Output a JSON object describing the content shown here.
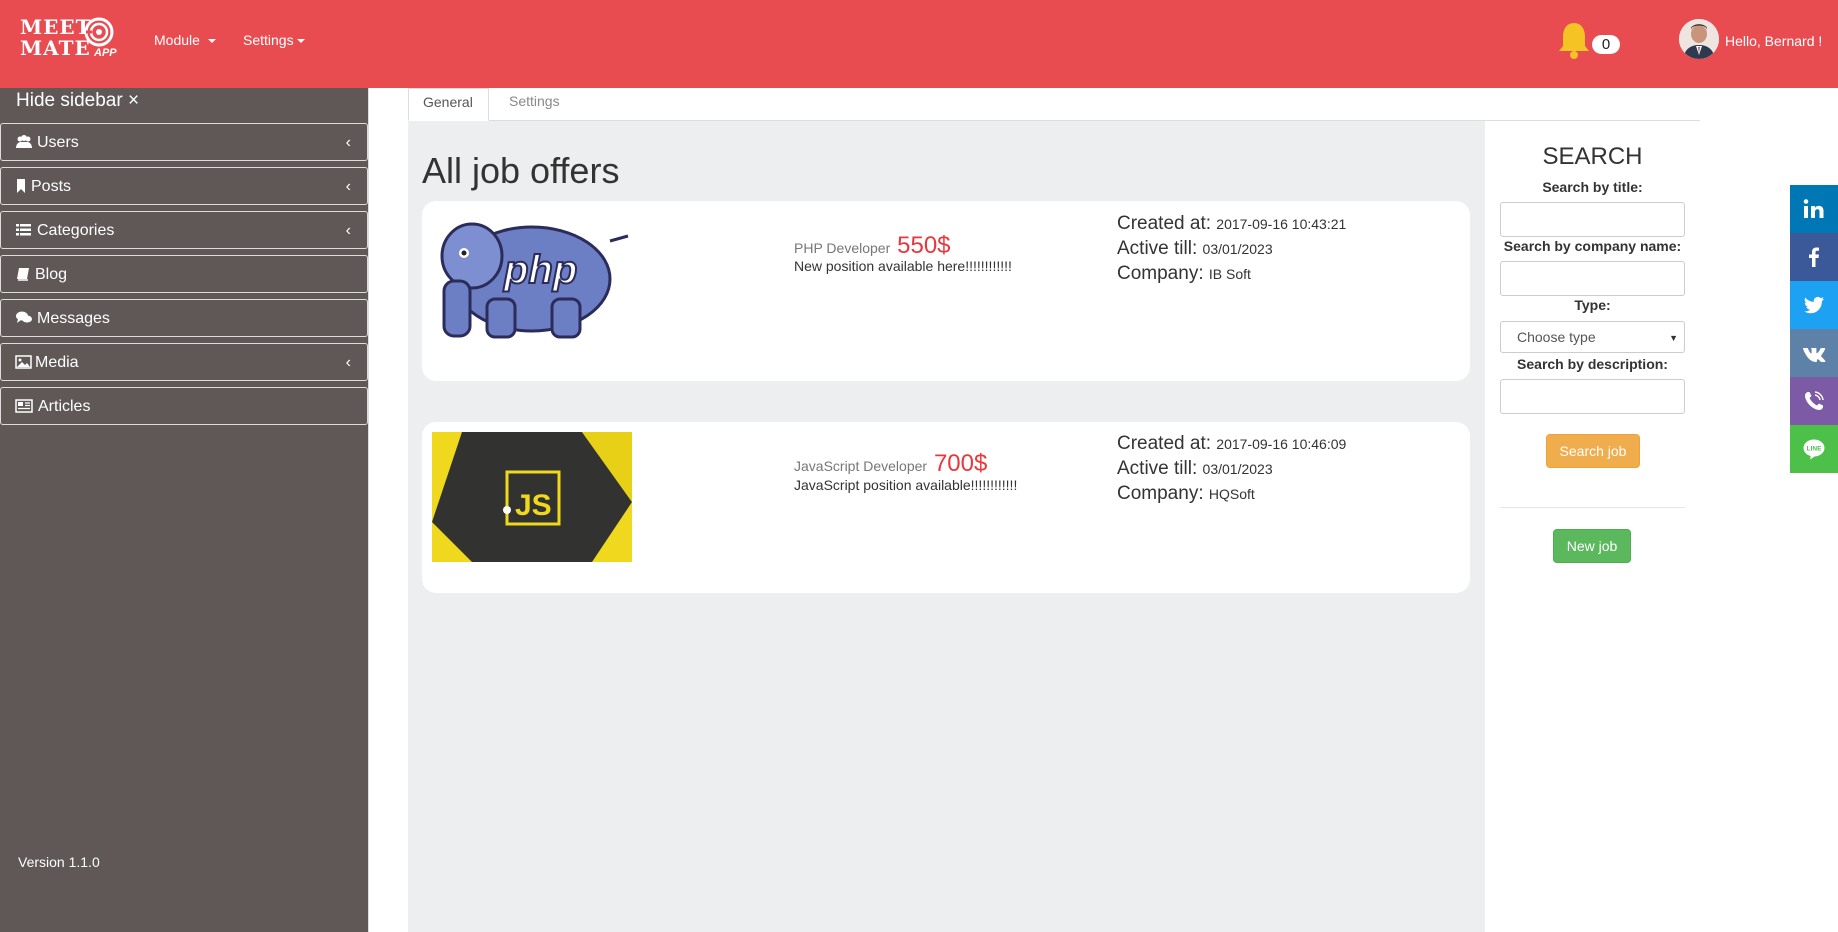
{
  "header": {
    "logo_line1": "MEET",
    "logo_line2": "MATE",
    "logo_app": "APP",
    "menu": [
      {
        "label": "Module"
      },
      {
        "label": "Settings"
      }
    ],
    "notification_count": "0",
    "greeting": "Hello, Bernard !"
  },
  "sidebar": {
    "hide_label": "Hide sidebar ×",
    "items": [
      {
        "label": "Users",
        "icon": "users-icon",
        "expandable": true
      },
      {
        "label": "Posts",
        "icon": "bookmark-icon",
        "expandable": true
      },
      {
        "label": "Categories",
        "icon": "list-icon",
        "expandable": true
      },
      {
        "label": "Blog",
        "icon": "book-icon",
        "expandable": false
      },
      {
        "label": "Messages",
        "icon": "comments-icon",
        "expandable": false
      },
      {
        "label": "Media",
        "icon": "image-icon",
        "expandable": true
      },
      {
        "label": "Articles",
        "icon": "newspaper-icon",
        "expandable": false
      }
    ],
    "chevron": "‹",
    "version": "Version 1.1.0"
  },
  "tabs": [
    {
      "label": "General",
      "active": true
    },
    {
      "label": "Settings",
      "active": false
    }
  ],
  "main": {
    "title": "All job offers",
    "jobs": [
      {
        "title": "PHP Developer",
        "price": "550$",
        "description": "New position available here!!!!!!!!!!!!",
        "created_label": "Created at:",
        "created": "2017-09-16 10:43:21",
        "active_label": "Active till:",
        "active_till": "03/01/2023",
        "company_label": "Company:",
        "company": "IB Soft",
        "image": "php-elephant-logo"
      },
      {
        "title": "JavaScript Developer",
        "price": "700$",
        "description": "JavaScript position available!!!!!!!!!!!!",
        "created_label": "Created at:",
        "created": "2017-09-16 10:46:09",
        "active_label": "Active till:",
        "active_till": "03/01/2023",
        "company_label": "Company:",
        "company": "HQSoft",
        "image": "javascript-logo"
      }
    ]
  },
  "search": {
    "title": "SEARCH",
    "by_title_label": "Search by title:",
    "by_title_value": "",
    "by_company_label": "Search by company name:",
    "by_company_value": "",
    "type_label": "Type:",
    "type_selected": "Choose type",
    "by_description_label": "Search by description:",
    "by_description_value": "",
    "search_button": "Search job",
    "new_button": "New job"
  },
  "social": [
    {
      "name": "linkedin",
      "color": "#0077b5"
    },
    {
      "name": "facebook",
      "color": "#3b5998"
    },
    {
      "name": "twitter",
      "color": "#1da1f2"
    },
    {
      "name": "vk",
      "color": "#5e81a8"
    },
    {
      "name": "viber",
      "color": "#7d5aa5"
    },
    {
      "name": "line",
      "color": "#4cc049"
    }
  ],
  "colors": {
    "header_bg": "#e84c51",
    "sidebar_bg": "#5f5857",
    "price": "#e8383d"
  }
}
